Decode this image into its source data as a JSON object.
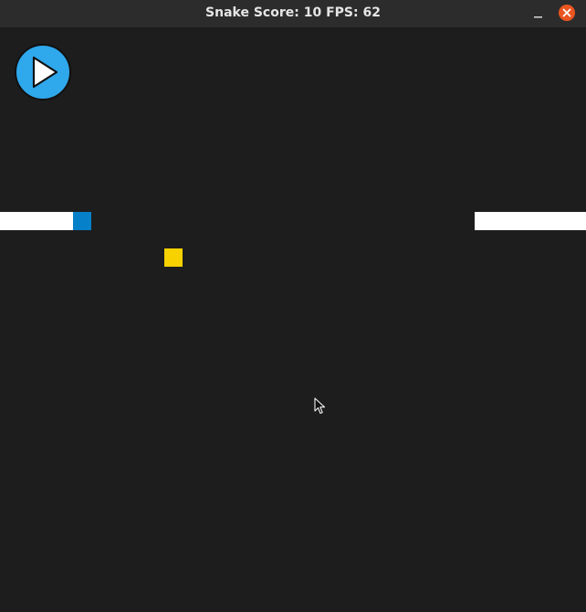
{
  "window": {
    "title": "Snake Score: 10 FPS: 62"
  },
  "controls": {
    "minimize_icon": "minimize-icon",
    "close_icon": "close-icon",
    "play_icon": "play-icon"
  },
  "game": {
    "score": 10,
    "fps": 62,
    "snake_body_color": "#ffffff",
    "snake_head_color": "#0680c8",
    "food_color": "#f7d100",
    "background_color": "#1d1d1d",
    "play_button_color": "#2fa8ec"
  }
}
